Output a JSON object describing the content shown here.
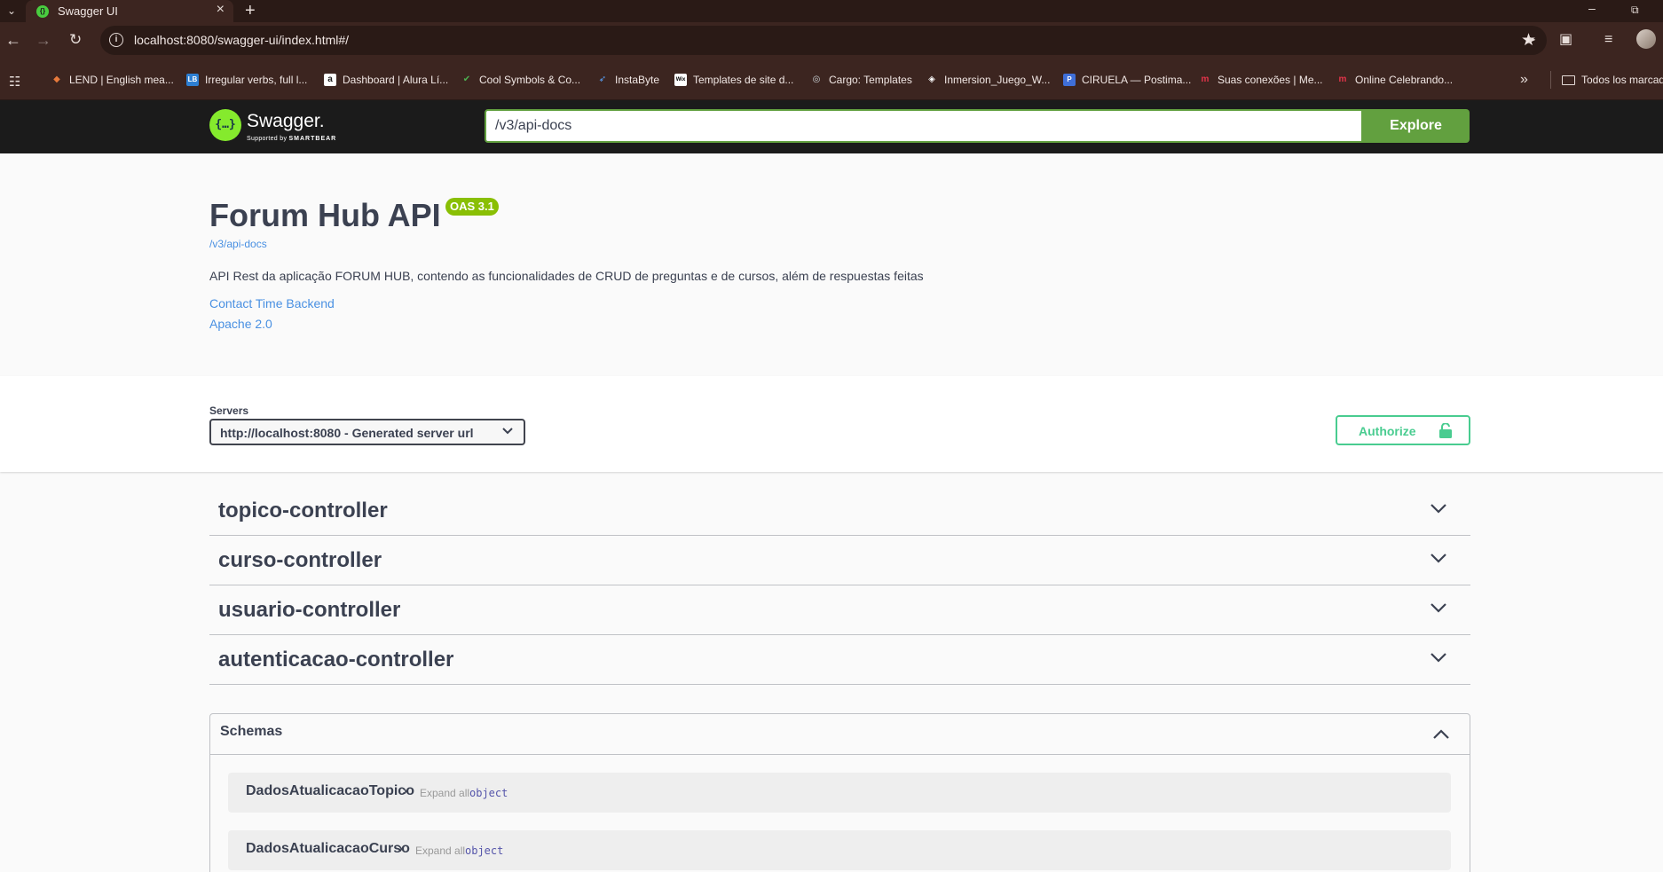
{
  "browser": {
    "tab_title": "Swagger UI",
    "url": "localhost:8080/swagger-ui/index.html#/",
    "bookmarks": [
      {
        "label": "LEND | English mea...",
        "icon": "lend-icon",
        "color": "#e87a3c"
      },
      {
        "label": "Irregular verbs, full l...",
        "icon": "lb-icon",
        "color": "#2d7fd3"
      },
      {
        "label": "Dashboard | Alura Lí...",
        "icon": "alura-icon",
        "color": "#ffffff"
      },
      {
        "label": "Cool Symbols & Co...",
        "icon": "checkmark-icon",
        "color": "#4caf50"
      },
      {
        "label": "InstaByte",
        "icon": "rocket-icon",
        "color": "#5aa6ff"
      },
      {
        "label": "Templates de site d...",
        "icon": "wix-icon",
        "color": "#ffffff"
      },
      {
        "label": "Cargo: Templates",
        "icon": "globe-icon",
        "color": "#cfd8dc"
      },
      {
        "label": "Inmersion_Juego_W...",
        "icon": "codepen-icon",
        "color": "#ffffff"
      },
      {
        "label": "CIRUELA — Postima...",
        "icon": "postimage-icon",
        "color": "#3f6fd8"
      },
      {
        "label": "Suas conexões | Me...",
        "icon": "meetup-icon",
        "color": "#e5344a"
      },
      {
        "label": "Online Celebrando...",
        "icon": "meetup-icon",
        "color": "#e5344a"
      }
    ],
    "bookmarks_folder": "Todos los marcad"
  },
  "swagger": {
    "logo_text": "Swagger.",
    "logo_sub_prefix": "Supported by",
    "logo_sub_brand": "SMARTBEAR",
    "url_value": "/v3/api-docs",
    "explore_label": "Explore"
  },
  "info": {
    "title": "Forum Hub API",
    "version_badge": "OAS 3.1",
    "spec_link": "/v3/api-docs",
    "description": "API Rest da aplicação FORUM HUB, contendo as funcionalidades de CRUD de preguntas e de cursos, além de respuestas feitas",
    "contact_link": "Contact Time Backend",
    "license_link": "Apache 2.0"
  },
  "servers": {
    "label": "Servers",
    "selected": "http://localhost:8080 - Generated server url",
    "authorize_label": "Authorize"
  },
  "controllers": [
    {
      "name": "topico-controller"
    },
    {
      "name": "curso-controller"
    },
    {
      "name": "usuario-controller"
    },
    {
      "name": "autenticacao-controller"
    }
  ],
  "schemas": {
    "title": "Schemas",
    "models": [
      {
        "name": "DadosAtualicacaoTopico",
        "expand_label": "Expand all",
        "type": "object"
      },
      {
        "name": "DadosAtualicacaoCurso",
        "expand_label": "Expand all",
        "type": "object"
      }
    ]
  },
  "colors": {
    "accent_green": "#62a03f",
    "authorize_green": "#49cc90",
    "badge_green": "#89bf04",
    "link_blue": "#4990e2"
  }
}
